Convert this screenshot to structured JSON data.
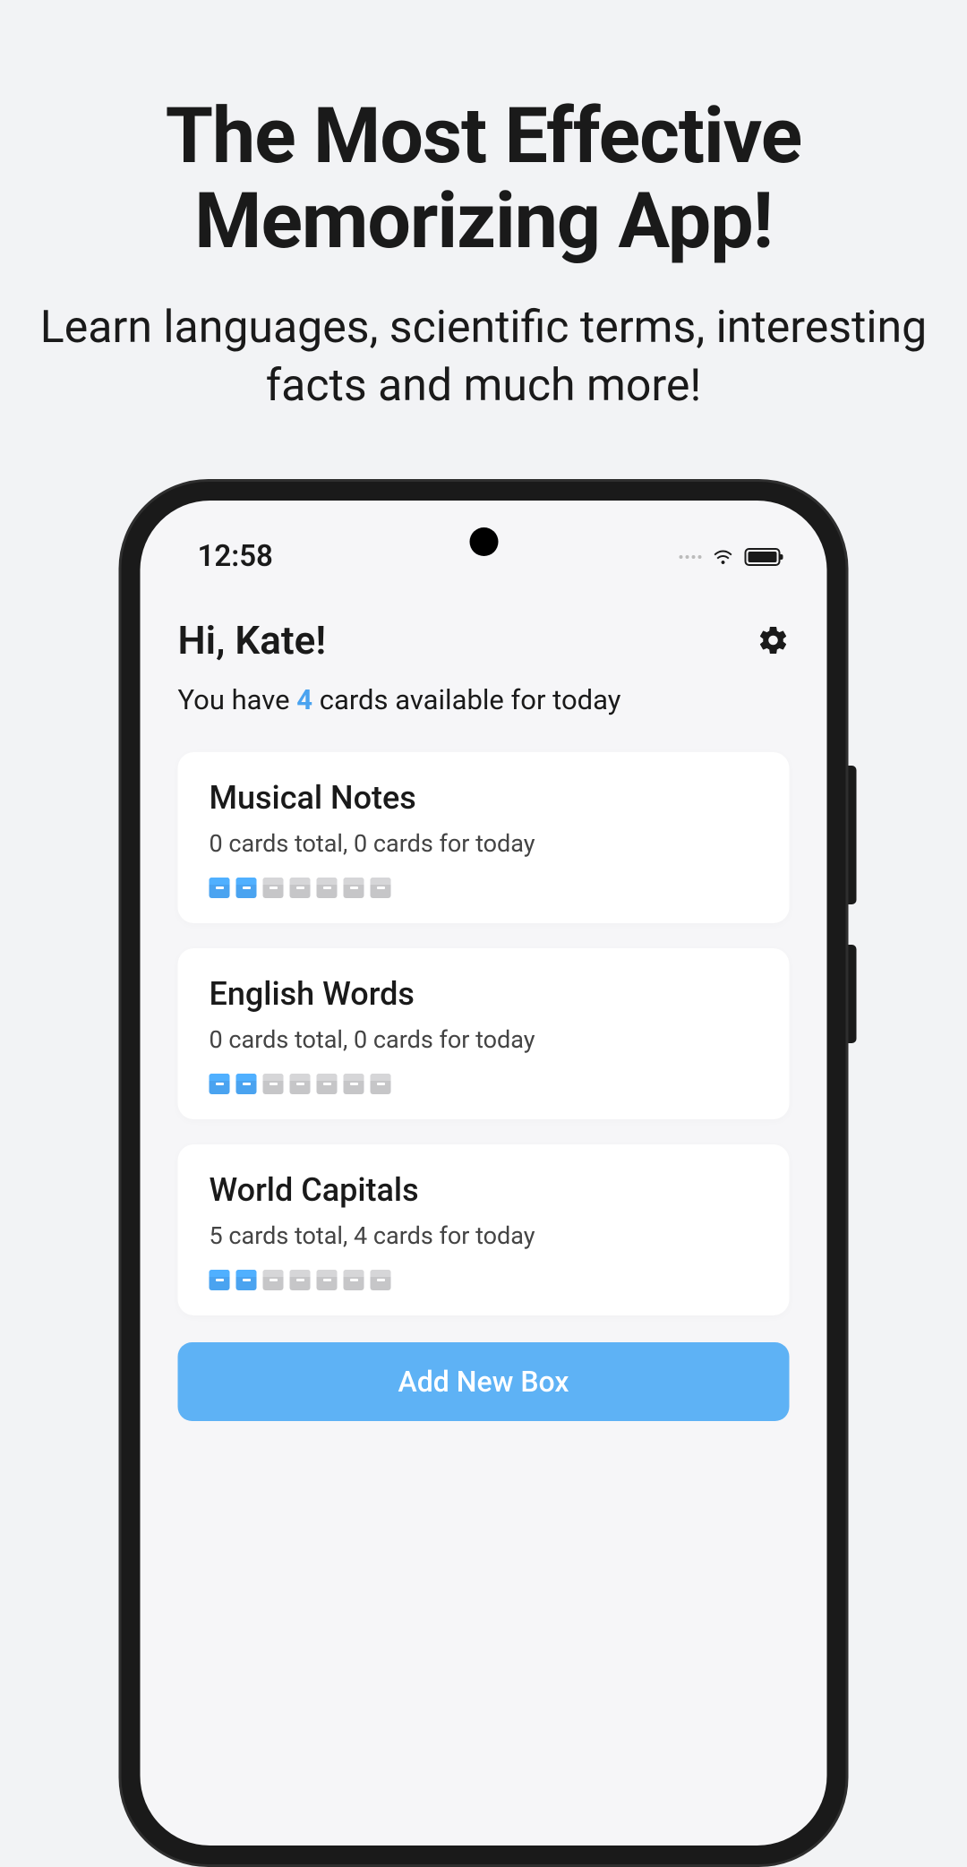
{
  "hero": {
    "title_line1": "The Most Effective",
    "title_line2": "Memorizing App!",
    "subtitle": "Learn languages, scientific terms, interesting facts and much more!"
  },
  "status": {
    "time": "12:58"
  },
  "header": {
    "greeting": "Hi, Kate!",
    "subtitle_prefix": "You have ",
    "subtitle_count": "4",
    "subtitle_suffix": " cards available for today"
  },
  "decks": [
    {
      "title": "Musical Notes",
      "info": "0 cards total, 0 cards for today",
      "active_boxes": 2,
      "total_boxes": 7
    },
    {
      "title": "English Words",
      "info": "0 cards total, 0 cards for today",
      "active_boxes": 2,
      "total_boxes": 7
    },
    {
      "title": "World Capitals",
      "info": "5 cards total, 4 cards for today",
      "active_boxes": 2,
      "total_boxes": 7
    }
  ],
  "add_button": {
    "label": "Add New Box"
  }
}
